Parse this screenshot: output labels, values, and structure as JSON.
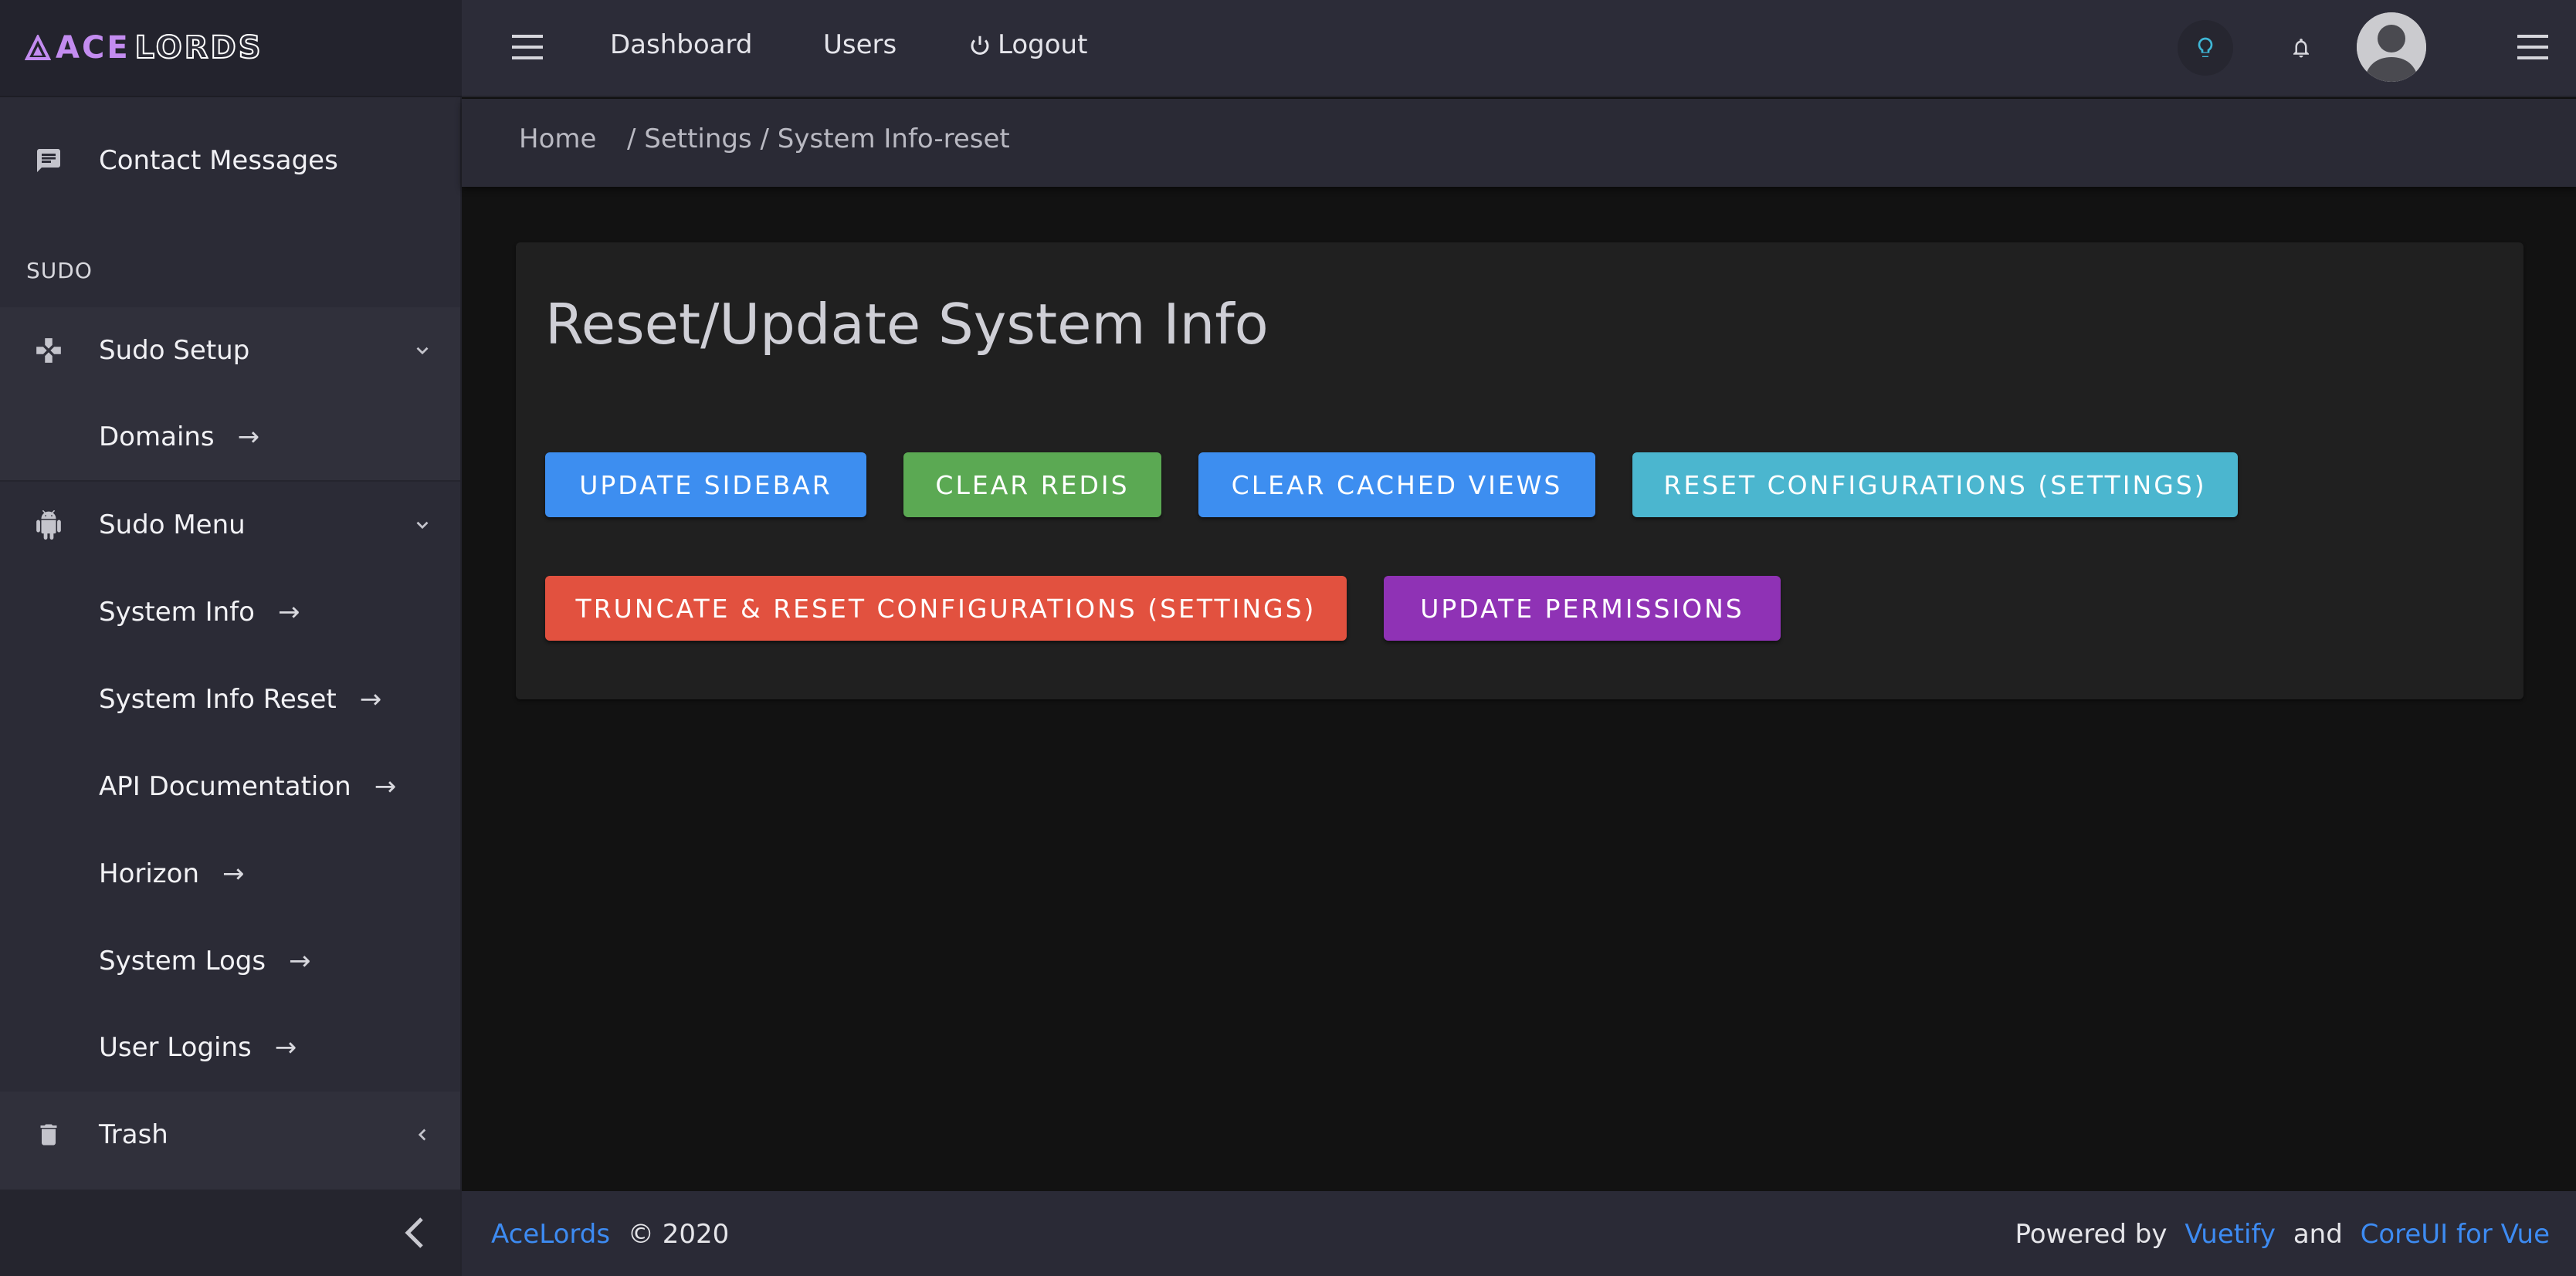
{
  "brand": {
    "name_part1": "ACE",
    "name_part2": "LORDS"
  },
  "sidebar": {
    "items": {
      "contact": {
        "label": "Contact Messages",
        "icon": "message-icon"
      },
      "sudo_title": "SUDO",
      "sudo_setup": {
        "label": "Sudo Setup",
        "icon": "gamepad-icon",
        "children": [
          {
            "label": "Domains"
          }
        ]
      },
      "sudo_menu": {
        "label": "Sudo Menu",
        "icon": "android-icon",
        "children": [
          {
            "label": "System Info"
          },
          {
            "label": "System Info Reset"
          },
          {
            "label": "API Documentation"
          },
          {
            "label": "Horizon"
          },
          {
            "label": "System Logs"
          },
          {
            "label": "User Logins"
          }
        ]
      },
      "trash": {
        "label": "Trash",
        "icon": "trash-icon"
      }
    },
    "arrow_glyph": "→"
  },
  "header": {
    "links": [
      {
        "label": "Dashboard"
      },
      {
        "label": "Users"
      },
      {
        "label": "Logout",
        "icon": "power-icon"
      }
    ],
    "icons": [
      "lightbulb-icon",
      "bell-icon",
      "avatar",
      "menu-icon"
    ]
  },
  "breadcrumb": {
    "home": "Home",
    "path": "/ Settings / System Info-reset"
  },
  "card": {
    "title": "Reset/Update System Info",
    "buttons": [
      {
        "label": "UPDATE SIDEBAR",
        "color": "#3d8ef0"
      },
      {
        "label": "CLEAR REDIS",
        "color": "#5ba953"
      },
      {
        "label": "CLEAR CACHED VIEWS",
        "color": "#3d8ef0"
      },
      {
        "label": "RESET CONFIGURATIONS (SETTINGS)",
        "color": "#4bb6cf"
      },
      {
        "label": "TRUNCATE & RESET CONFIGURATIONS (SETTINGS)",
        "color": "#e2513f"
      },
      {
        "label": "UPDATE PERMISSIONS",
        "color": "#8f32b5"
      }
    ]
  },
  "footer": {
    "brand_link": "AceLords",
    "copyright": "© 2020",
    "powered_by": "Powered by",
    "vuetify_link": "Vuetify",
    "and": "and",
    "coreui_link": "CoreUI for Vue"
  },
  "colors": {
    "sidebar_bg": "#2b2b36",
    "header_bg": "#2c2c38",
    "content_bg": "#121212",
    "card_bg": "#202020",
    "link": "#3d8bf2",
    "bulb": "#3fb7d6"
  }
}
